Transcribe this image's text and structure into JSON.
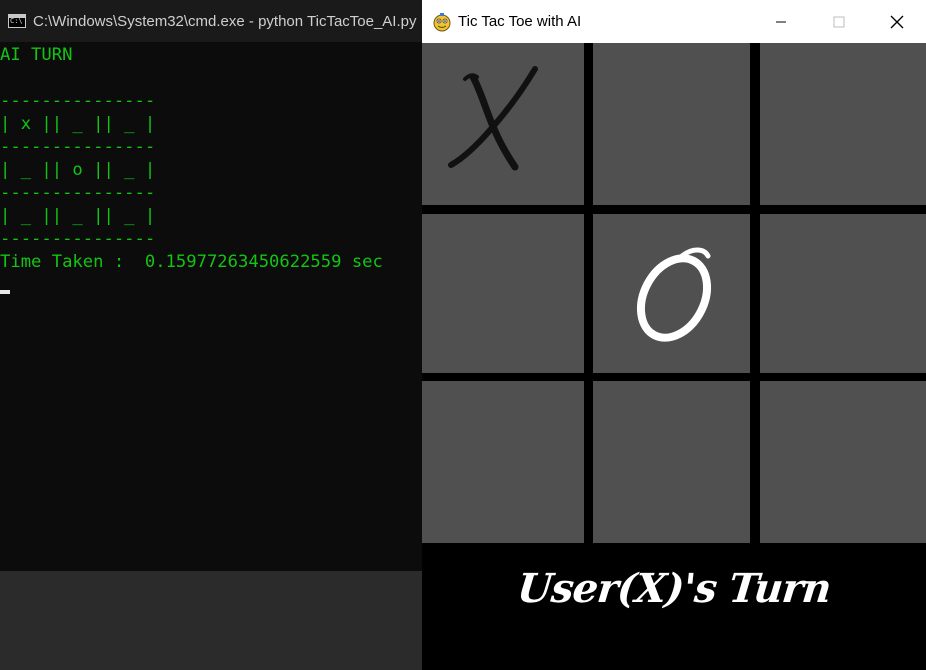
{
  "cmd": {
    "title": "C:\\Windows\\System32\\cmd.exe - python  TicTacToe_AI.py",
    "lines": [
      "AI TURN",
      "",
      "---------------",
      "| x || _ || _ |",
      "---------------",
      "| _ || o || _ |",
      "---------------",
      "| _ || _ || _ |",
      "---------------",
      "Time Taken :  0.15977263450622559 sec"
    ],
    "text_color": "#13c413"
  },
  "game": {
    "title": "Tic Tac Toe with AI",
    "board": [
      [
        "X",
        "",
        ""
      ],
      [
        "",
        "O",
        ""
      ],
      [
        "",
        "",
        ""
      ]
    ],
    "status": "User(X)'s Turn",
    "cell_color": "#505050",
    "grid_color": "#000000",
    "icons": {
      "app": "pygame-snake-icon",
      "minimize": "minimize-icon",
      "maximize": "maximize-icon",
      "close": "close-icon"
    }
  }
}
